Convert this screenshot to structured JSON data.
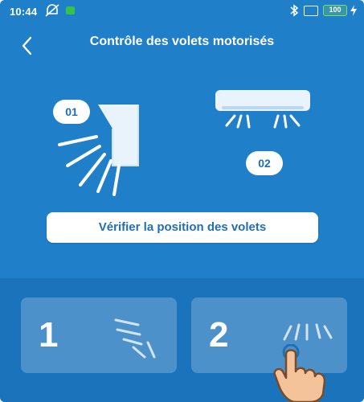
{
  "status_bar": {
    "time": "10:44",
    "battery": "100"
  },
  "header": {
    "title": "Contrôle des volets motorisés"
  },
  "illustration": {
    "badge_1": "01",
    "badge_2": "02"
  },
  "actions": {
    "check_label": "Vérifier la position des volets"
  },
  "tiles": [
    {
      "number": "1"
    },
    {
      "number": "2"
    }
  ],
  "colors": {
    "primary": "#1f7fc9",
    "tile_bg": "#1a73bb",
    "white": "#ffffff",
    "accent_text": "#1f6fb5",
    "hand_skin": "#f4c39a"
  }
}
